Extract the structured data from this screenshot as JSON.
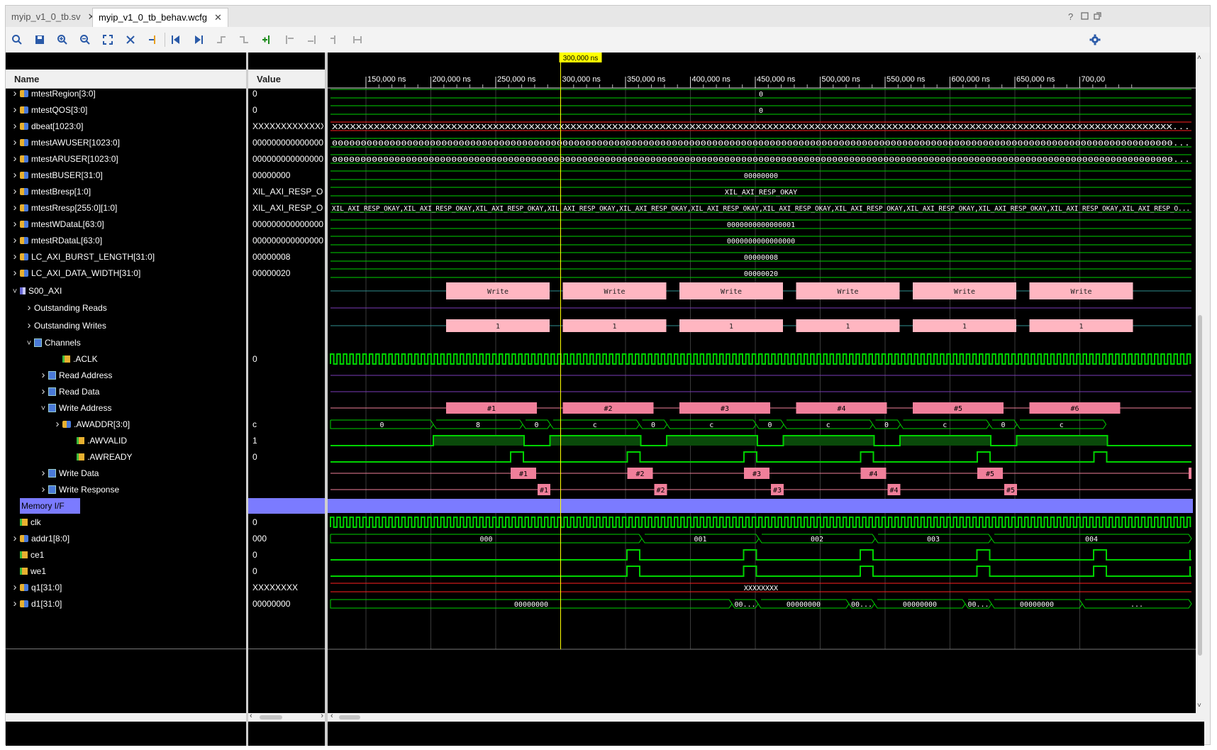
{
  "tabs": [
    {
      "label": "myip_v1_0_tb.sv",
      "active": false
    },
    {
      "label": "myip_v1_0_tb_behav.wcfg",
      "active": true
    }
  ],
  "window_controls": [
    "?",
    "restore",
    "maximize"
  ],
  "toolbar_icons": [
    "search-icon",
    "save-icon",
    "zoom-in-icon",
    "zoom-out-icon",
    "zoom-fit-icon",
    "cursor-icon",
    "add-marker-icon",
    "go-to-start-icon",
    "go-to-end-icon",
    "prev-transition-icon",
    "next-transition-icon",
    "add-marker-plus-icon",
    "prev-marker-icon",
    "next-marker-icon",
    "swap-cursors-icon",
    "snap-icon",
    "settings-icon"
  ],
  "columns": {
    "name": "Name",
    "value": "Value"
  },
  "cursor": {
    "label": "300,000 ns",
    "time_ns": 300000
  },
  "timeline": {
    "unit": "ns",
    "ticks": [
      "150,000 ns",
      "200,000 ns",
      "250,000 ns",
      "300,000 ns",
      "350,000 ns",
      "400,000 ns",
      "450,000 ns",
      "500,000 ns",
      "550,000 ns",
      "600,000 ns",
      "650,000 ns",
      "700,00"
    ]
  },
  "signals": [
    {
      "name": "mtestRegion[3:0]",
      "value": "0",
      "indent": 0,
      "expand": "closed",
      "icon": "bus",
      "wave": "bus",
      "label": "0"
    },
    {
      "name": "mtestQOS[3:0]",
      "value": "0",
      "indent": 0,
      "expand": "closed",
      "icon": "bus",
      "wave": "bus",
      "label": "0"
    },
    {
      "name": "dbeat[1023:0]",
      "value": "XXXXXXXXXXXXXXXX",
      "indent": 0,
      "expand": "closed",
      "icon": "bus",
      "wave": "xbus",
      "label": "XXXXXXXXXXXXXXXXXXXXXXXXXXXXXXXXXXXXXXXXXXXXXXXXXXXXXXXXXXXXXXXXXXXXXXXXXXXXXXXXXXXXXXXXXXXXXXXXXXXXXXXXXXXXXXXXXXXXXXXXXXXXXXXXXXXXXXXXXXXXX..."
    },
    {
      "name": "mtestAWUSER[1023:0]",
      "value": "0000000000000000",
      "indent": 0,
      "expand": "closed",
      "icon": "bus",
      "wave": "bus",
      "label": "00000000000000000000000000000000000000000000000000000000000000000000000000000000000000000000000000000000000000000000000000000000000000000000000000..."
    },
    {
      "name": "mtestARUSER[1023:0]",
      "value": "0000000000000000",
      "indent": 0,
      "expand": "closed",
      "icon": "bus",
      "wave": "bus",
      "label": "0000000000000000000000000000000000000000000000000000000000000000000000000000000000000000000000000000000000000000000000000000000000000000000000000000..."
    },
    {
      "name": "mtestBUSER[31:0]",
      "value": "00000000",
      "indent": 0,
      "expand": "closed",
      "icon": "bus",
      "wave": "bus",
      "label": "00000000"
    },
    {
      "name": "mtestBresp[1:0]",
      "value": "XIL_AXI_RESP_OKAY",
      "indent": 0,
      "expand": "closed",
      "icon": "bus",
      "wave": "bus",
      "label": "XIL_AXI_RESP_OKAY"
    },
    {
      "name": "mtestRresp[255:0][1:0]",
      "value": "XIL_AXI_RESP_OKAY",
      "indent": 0,
      "expand": "closed",
      "icon": "bus",
      "wave": "bus",
      "label": "XIL_AXI_RESP_OKAY,XIL_AXI_RESP_OKAY,XIL_AXI_RESP_OKAY,XIL_AXI_RESP_OKAY,XIL_AXI_RESP_OKAY,XIL_AXI_RESP_OKAY,XIL_AXI_RESP_OKAY,XIL_AXI_RESP_OKAY,XIL_AXI_RESP_OKAY,XIL_AXI_RESP_OKAY,XIL_AXI_RESP_OKAY,XIL_AXI_RESP_O..."
    },
    {
      "name": "mtestWDataL[63:0]",
      "value": "0000000000000001",
      "indent": 0,
      "expand": "closed",
      "icon": "bus",
      "wave": "bus",
      "label": "0000000000000001"
    },
    {
      "name": "mtestRDataL[63:0]",
      "value": "0000000000000000",
      "indent": 0,
      "expand": "closed",
      "icon": "bus",
      "wave": "bus",
      "label": "0000000000000000"
    },
    {
      "name": "LC_AXI_BURST_LENGTH[31:0]",
      "value": "00000008",
      "indent": 0,
      "expand": "closed",
      "icon": "bus",
      "wave": "bus",
      "label": "00000008"
    },
    {
      "name": "LC_AXI_DATA_WIDTH[31:0]",
      "value": "00000020",
      "indent": 0,
      "expand": "closed",
      "icon": "bus",
      "wave": "bus",
      "label": "00000020"
    },
    {
      "name": "S00_AXI",
      "value": "",
      "indent": 0,
      "expand": "open",
      "icon": "ifc",
      "wave": "txn",
      "label": "Write",
      "tall": true
    },
    {
      "name": "Outstanding Reads",
      "value": "",
      "indent": 1,
      "expand": "closed",
      "icon": "none",
      "wave": "lane-purple",
      "label": ""
    },
    {
      "name": "Outstanding Writes",
      "value": "",
      "indent": 1,
      "expand": "closed",
      "icon": "none",
      "wave": "txn",
      "label": "1"
    },
    {
      "name": "Channels",
      "value": "",
      "indent": 1,
      "expand": "open",
      "icon": "grp",
      "wave": "none",
      "label": ""
    },
    {
      "name": ".ACLK",
      "value": "0",
      "indent": 3,
      "expand": "none",
      "icon": "bit",
      "wave": "clock",
      "label": ""
    },
    {
      "name": "Read Address",
      "value": "",
      "indent": 2,
      "expand": "closed",
      "icon": "grp",
      "wave": "lane-purple",
      "label": ""
    },
    {
      "name": "Read Data",
      "value": "",
      "indent": 2,
      "expand": "closed",
      "icon": "grp",
      "wave": "lane-purple",
      "label": ""
    },
    {
      "name": "Write Address",
      "value": "",
      "indent": 2,
      "expand": "open",
      "icon": "grp",
      "wave": "awtxn",
      "label": ""
    },
    {
      "name": ".AWADDR[3:0]",
      "value": "c",
      "indent": 3,
      "expand": "closed",
      "icon": "bus",
      "wave": "awaddr",
      "label": ""
    },
    {
      "name": ".AWVALID",
      "value": "1",
      "indent": 4,
      "expand": "none",
      "icon": "bit",
      "wave": "awvalid",
      "label": ""
    },
    {
      "name": ".AWREADY",
      "value": "0",
      "indent": 4,
      "expand": "none",
      "icon": "bit",
      "wave": "awready",
      "label": ""
    },
    {
      "name": "Write Data",
      "value": "",
      "indent": 2,
      "expand": "closed",
      "icon": "grp",
      "wave": "wtxn",
      "label": ""
    },
    {
      "name": "Write Response",
      "value": "",
      "indent": 2,
      "expand": "closed",
      "icon": "grp",
      "wave": "btxn",
      "label": ""
    },
    {
      "name": "Memory I/F",
      "value": "",
      "indent": 0,
      "expand": "none",
      "icon": "none",
      "wave": "divider",
      "label": ""
    },
    {
      "name": "clk",
      "value": "0",
      "indent": 0,
      "expand": "none",
      "icon": "bit",
      "wave": "clock",
      "label": ""
    },
    {
      "name": "addr1[8:0]",
      "value": "000",
      "indent": 0,
      "expand": "closed",
      "icon": "bus",
      "wave": "addr1",
      "label": ""
    },
    {
      "name": "ce1",
      "value": "0",
      "indent": 0,
      "expand": "none",
      "icon": "bit",
      "wave": "pulse",
      "label": ""
    },
    {
      "name": "we1",
      "value": "0",
      "indent": 0,
      "expand": "none",
      "icon": "bit",
      "wave": "pulse",
      "label": ""
    },
    {
      "name": "q1[31:0]",
      "value": "XXXXXXXX",
      "indent": 0,
      "expand": "closed",
      "icon": "bus",
      "wave": "xbus",
      "label": "XXXXXXXX"
    },
    {
      "name": "d1[31:0]",
      "value": "00000000",
      "indent": 0,
      "expand": "closed",
      "icon": "bus",
      "wave": "d1",
      "label": ""
    }
  ],
  "transactions": {
    "s00_axi": [
      "Write",
      "Write",
      "Write",
      "Write",
      "Write",
      "Write"
    ],
    "outstanding_writes": [
      "1",
      "1",
      "1",
      "1",
      "1",
      "1"
    ],
    "write_address": [
      "#1",
      "#2",
      "#3",
      "#4",
      "#5",
      "#6"
    ],
    "write_data": [
      "#1",
      "#2",
      "#3",
      "#4",
      "#5"
    ],
    "write_response": [
      "#1",
      "#2",
      "#3",
      "#4",
      "#5"
    ]
  },
  "awaddr_segments": [
    "0",
    "8",
    "0",
    "c",
    "0",
    "c",
    "0",
    "c",
    "0",
    "c",
    "0",
    "c"
  ],
  "addr1_segments": [
    "000",
    "001",
    "002",
    "003",
    "004"
  ],
  "d1_segments": [
    "00000000",
    "00...",
    "00000000",
    "00...",
    "00000000",
    "00...",
    "00000000",
    "..."
  ],
  "colors": {
    "wave_green": "#00d200",
    "txn_pink": "#ffb6c1",
    "chan_pink": "#f07f9a",
    "cursor_yellow": "#ffff00",
    "divider_blue": "#7b7bff",
    "x_red": "#ff2020",
    "lane_purple": "#7a3db8"
  }
}
